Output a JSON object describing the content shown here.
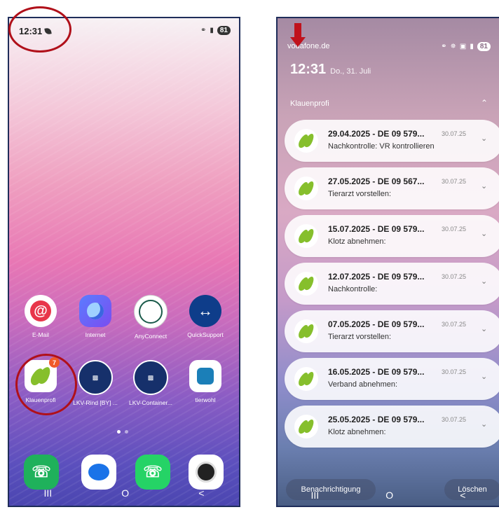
{
  "left_phone": {
    "status": {
      "time": "12:31",
      "battery": "81"
    },
    "apps_row1": [
      {
        "label": "E-Mail"
      },
      {
        "label": "Internet"
      },
      {
        "label": "AnyConnect"
      },
      {
        "label": "QuickSupport"
      }
    ],
    "apps_row2": [
      {
        "label": "Klauenprofi",
        "badge": "7"
      },
      {
        "label": "LKV-Rind [BY] ..."
      },
      {
        "label": "LKV-Container..."
      },
      {
        "label": "tierwohl"
      }
    ],
    "nav": {
      "recents": "III",
      "home": "O",
      "back": "<"
    }
  },
  "right_phone": {
    "status": {
      "carrier": "vodafone.de",
      "battery": "81"
    },
    "clock": {
      "time": "12:31",
      "date": "Do., 31. Juli"
    },
    "group_title": "Klauenprofi",
    "notifications": [
      {
        "title": "29.04.2025 - DE 09 579...",
        "time": "30.07.25",
        "body": "Nachkontrolle: VR kontrollieren"
      },
      {
        "title": "27.05.2025 - DE 09 567...",
        "time": "30.07.25",
        "body": "Tierarzt vorstellen:"
      },
      {
        "title": "15.07.2025 - DE 09 579...",
        "time": "30.07.25",
        "body": "Klotz abnehmen:"
      },
      {
        "title": "12.07.2025 - DE 09 579...",
        "time": "30.07.25",
        "body": "Nachkontrolle:"
      },
      {
        "title": "07.05.2025 - DE 09 579...",
        "time": "30.07.25",
        "body": "Tierarzt vorstellen:"
      },
      {
        "title": "16.05.2025 - DE 09 579...",
        "time": "30.07.25",
        "body": "Verband abnehmen:"
      },
      {
        "title": "25.05.2025 - DE 09 579...",
        "time": "30.07.25",
        "body": "Klotz abnehmen:"
      }
    ],
    "buttons": {
      "settings": "Benachrichtigung",
      "clear": "Löschen"
    },
    "nav": {
      "recents": "III",
      "home": "O",
      "back": "<"
    }
  },
  "colors": {
    "annotation_red": "#b0101a",
    "leaf_green": "#86bf2c"
  }
}
